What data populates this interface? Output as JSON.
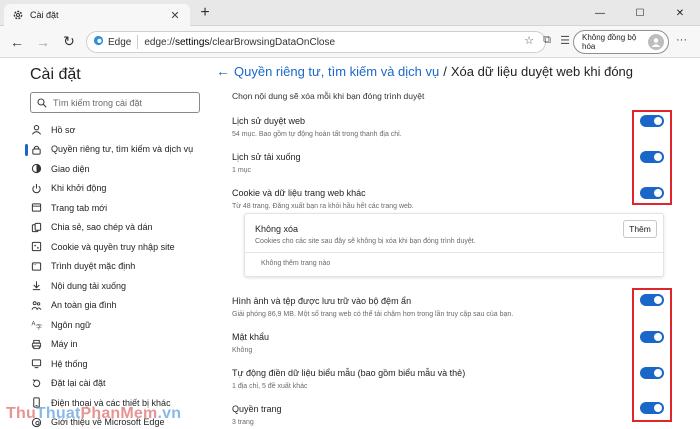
{
  "browser": {
    "tab_title": "Cài đặt",
    "new_tab_symbol": "+",
    "url_scheme_label": "Edge",
    "url_prefix": "edge://",
    "url_host": "settings",
    "url_path": "/clearBrowsingDataOnClose",
    "profile_label": "Không đồng bộ hóa"
  },
  "sidebar": {
    "title": "Cài đặt",
    "search_placeholder": "Tìm kiếm trong cài đặt",
    "items": [
      {
        "label": "Hồ sơ",
        "icon": "person-icon"
      },
      {
        "label": "Quyền riêng tư, tìm kiếm và dịch vụ",
        "icon": "lock-icon",
        "active": true
      },
      {
        "label": "Giao diện",
        "icon": "appearance-icon"
      },
      {
        "label": "Khi khởi động",
        "icon": "power-icon"
      },
      {
        "label": "Trang tab mới",
        "icon": "new-tab-icon"
      },
      {
        "label": "Chia sẻ, sao chép và dán",
        "icon": "share-icon"
      },
      {
        "label": "Cookie và quyền truy nhập site",
        "icon": "cookie-permissions-icon"
      },
      {
        "label": "Trình duyệt mặc định",
        "icon": "browser-icon"
      },
      {
        "label": "Nội dung tải xuống",
        "icon": "download-icon"
      },
      {
        "label": "An toàn gia đình",
        "icon": "family-icon"
      },
      {
        "label": "Ngôn ngữ",
        "icon": "language-icon"
      },
      {
        "label": "Máy in",
        "icon": "printer-icon"
      },
      {
        "label": "Hệ thống",
        "icon": "system-icon"
      },
      {
        "label": "Đặt lại cài đặt",
        "icon": "reset-icon"
      },
      {
        "label": "Điện thoại và các thiết bị khác",
        "icon": "phone-icon"
      },
      {
        "label": "Giới thiệu về Microsoft Edge",
        "icon": "edge-icon"
      }
    ]
  },
  "main": {
    "breadcrumb_link": "Quyền riêng tư, tìm kiếm và dịch vụ",
    "breadcrumb_sep": "/",
    "title": "Xóa dữ liệu duyệt web khi đóng",
    "intro": "Chọn nội dung sẽ xóa mỗi khi bạn đóng trình duyệt",
    "rows": [
      {
        "title": "Lịch sử duyệt web",
        "sub": "54 mục. Bao gồm tự động hoàn tất trong thanh địa chỉ.",
        "on": true
      },
      {
        "title": "Lịch sử tải xuống",
        "sub": "1 mục",
        "on": true
      },
      {
        "title": "Cookie và dữ liệu trang web khác",
        "sub": "Từ 48 trang. Đăng xuất bạn ra khỏi hầu hết các trang web.",
        "on": true
      },
      {
        "title": "Hình ảnh và tệp được lưu trữ vào bộ đệm ẩn",
        "sub": "Giải phóng 86,9 MB. Một số trang web có thể tải chậm hơn trong lần truy cập sau của bạn.",
        "on": true
      },
      {
        "title": "Mật khẩu",
        "sub": "Không",
        "on": true
      },
      {
        "title": "Tự động điền dữ liệu biểu mẫu (bao gồm biểu mẫu và thẻ)",
        "sub": "1 địa chỉ, 5 đề xuất khác",
        "on": true
      },
      {
        "title": "Quyền trang",
        "sub": "3 trang",
        "on": true
      }
    ],
    "exceptions": {
      "title": "Không xóa",
      "sub": "Cookies cho các site sau đây sẽ không bị xóa khi bạn đóng trình duyệt.",
      "add_button": "Thêm",
      "empty": "Không thêm trang nào"
    }
  },
  "watermark": {
    "part1": "Thu",
    "part2": "Thuat",
    "part3": "PhanMem",
    "part4": ".vn"
  },
  "colors": {
    "accent": "#1a67c9",
    "highlight": "#e0252b"
  }
}
